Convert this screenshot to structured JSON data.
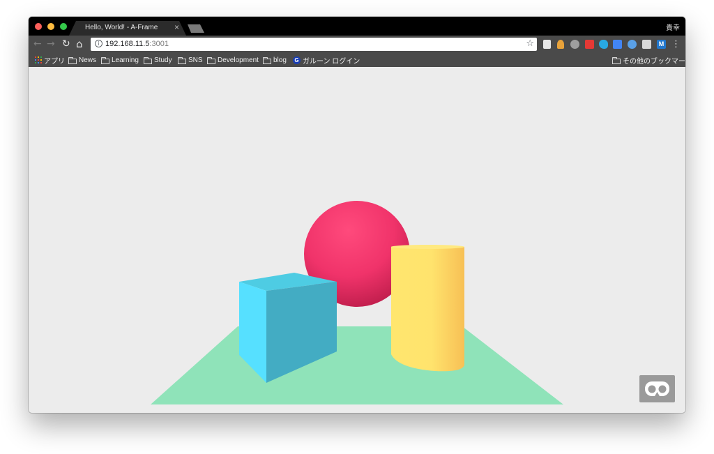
{
  "browser": {
    "tab_title": "Hello, World! - A-Frame",
    "tab_close": "×",
    "profile_name": "貴幸",
    "url_host": "192.168.11.5",
    "url_port": ":3001",
    "info_icon": "i",
    "star_icon": "☆",
    "menu_icon": "⋮",
    "nav": {
      "back": "←",
      "forward": "→",
      "reload": "↻",
      "home": "⌂"
    }
  },
  "bookmarks": {
    "left": [
      "アプリ",
      "News",
      "Learning",
      "Study",
      "SNS",
      "Development",
      "blog",
      "ガルーン ログイン"
    ],
    "right": "その他のブックマーク"
  },
  "scene": {
    "background": "#ececec",
    "plane_color": "#8fe3b9",
    "sphere_color": "#f13a6b",
    "box_color": "#4cc3d9",
    "cylinder_color": "#ffc65d",
    "vr_button_color": "#9a9a9a"
  }
}
